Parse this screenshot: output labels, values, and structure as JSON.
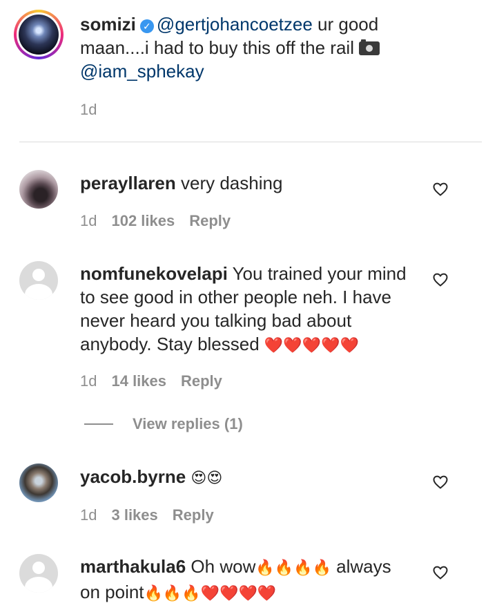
{
  "caption": {
    "username": "somizi",
    "mention1": "@gertjohancoetzee",
    "text1": " ur good maan....i had to buy this off the rail ",
    "mention2": "@iam_sphekay",
    "time": "1d"
  },
  "comments": [
    {
      "username": "perayllaren",
      "text": "very dashing",
      "time": "1d",
      "likes": "102 likes",
      "reply": "Reply",
      "emojis": ""
    },
    {
      "username": "nomfunekovelapi",
      "text": "You trained your mind to see good in other people neh. I have never heard you talking bad about anybody. Stay blessed",
      "emojis": "❤️❤️❤️❤️❤️",
      "time": "1d",
      "likes": "14 likes",
      "reply": "Reply"
    },
    {
      "username": "yacob.byrne",
      "text": "",
      "emojis": "😍😍",
      "time": "1d",
      "likes": "3 likes",
      "reply": "Reply"
    },
    {
      "username": "marthakula6",
      "text": "Oh wow",
      "emojis": "🔥🔥🔥🔥",
      "text2": " always on point",
      "emojis2": "🔥🔥🔥❤️❤️❤️❤️"
    }
  ],
  "view_replies": "View replies (1)",
  "icons": {
    "verified": "verified-badge-icon",
    "camera": "camera-icon",
    "heart": "heart-outline-icon"
  },
  "colors": {
    "mention": "#00376b",
    "verified": "#3897f0",
    "muted": "#8e8e8e",
    "heart_emoji": "#e0245e",
    "fire_emoji": "#ff6b1a"
  }
}
